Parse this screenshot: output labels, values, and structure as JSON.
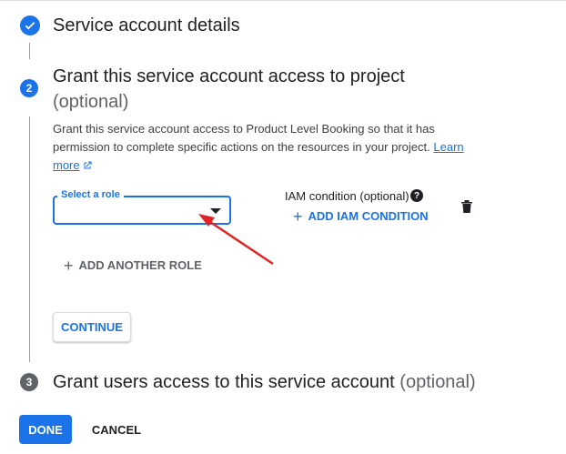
{
  "steps": {
    "step1": {
      "title": "Service account details",
      "icon": "check-icon"
    },
    "step2": {
      "number": "2",
      "title": "Grant this service account access to project",
      "optional": "(optional)",
      "description": "Grant this service account access to Product Level Booking so that it has permission to complete specific actions on the resources in your project.",
      "learn_more": "Learn more"
    },
    "step3": {
      "number": "3",
      "title": "Grant users access to this service account",
      "optional": "(optional)"
    }
  },
  "role": {
    "label": "Select a role",
    "value": ""
  },
  "iam": {
    "label": "IAM condition (optional)",
    "add_label": "ADD IAM CONDITION",
    "help_icon": "?"
  },
  "buttons": {
    "add_another_role": "ADD ANOTHER ROLE",
    "continue": "CONTINUE",
    "done": "DONE",
    "cancel": "CANCEL"
  },
  "colors": {
    "accent": "#1a73e8",
    "annotation_arrow": "#e02424"
  }
}
